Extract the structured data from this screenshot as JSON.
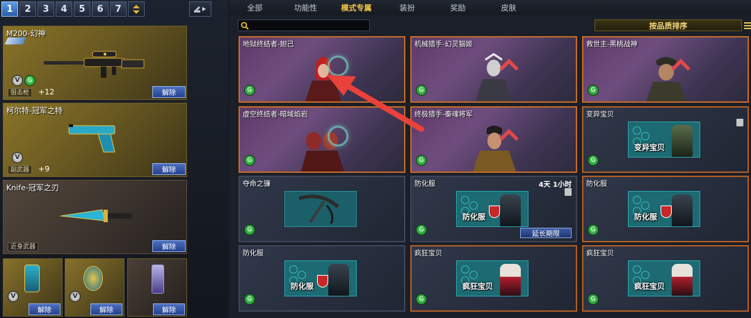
{
  "loadout": {
    "slots": [
      "1",
      "2",
      "3",
      "4",
      "5",
      "6",
      "7"
    ],
    "active_slot": "1"
  },
  "weapons": [
    {
      "name": "M200-幻神",
      "category": "狙击枪",
      "level": "+12",
      "unequip": "解除"
    },
    {
      "name": "柯尔特-冠军之特",
      "category": "副武器",
      "level": "+9",
      "unequip": "解除"
    },
    {
      "name": "Knife-冠军之刃",
      "category": "近身武器",
      "level": "",
      "unequip": "解除"
    }
  ],
  "small_slots": [
    {
      "unequip": "解除"
    },
    {
      "unequip": "解除"
    },
    {
      "unequip": "解除"
    }
  ],
  "badges": {
    "v": "V",
    "g": "G"
  },
  "tabs": [
    "全部",
    "功能性",
    "模式专属",
    "装扮",
    "奖励",
    "皮肤"
  ],
  "active_tab": "模式专属",
  "sort_label": "按品质排序",
  "items": [
    {
      "name": "地狱终结者-妲己",
      "style": "orange"
    },
    {
      "name": "机械猎手-幻灵猫姬",
      "style": "orange"
    },
    {
      "name": "救世主-黑桃战神",
      "style": "orange"
    },
    {
      "name": "虚空终结者-暗域焰岩",
      "style": "orange"
    },
    {
      "name": "终极猎手-秦魂将军",
      "style": "orange"
    },
    {
      "name": "变异宝贝",
      "style": "darkorange",
      "art_label": "变异宝贝"
    },
    {
      "name": "夺命之镰",
      "style": "dark"
    },
    {
      "name": "防化服",
      "style": "dark",
      "timer": "4天 1小时",
      "art_label": "防化服",
      "extend": "延长期限"
    },
    {
      "name": "防化服",
      "style": "darkorange",
      "art_label": "防化服"
    },
    {
      "name": "防化服",
      "style": "dark",
      "art_label": "防化服"
    },
    {
      "name": "疯狂宝贝",
      "style": "darkorange",
      "art_label": "疯狂宝贝"
    },
    {
      "name": "疯狂宝贝",
      "style": "darkorange",
      "art_label": "疯狂宝贝"
    }
  ],
  "colors": {
    "accent": "#f1c54b",
    "card_border_orange": "#c26b28",
    "arrow": "#e8423a"
  }
}
